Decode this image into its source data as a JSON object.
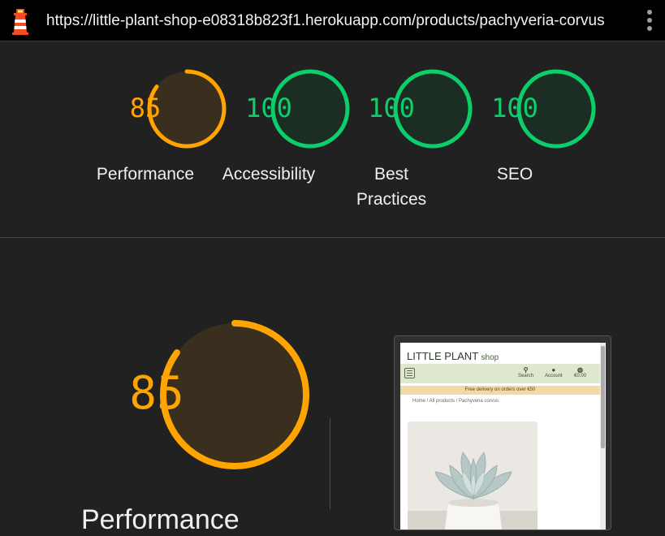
{
  "browser": {
    "url": "https://little-plant-shop-e08318b823f1.herokuapp.com/products/pachyveria-corvus",
    "logo_icon": "lighthouse-icon",
    "menu_icon": "kebab-menu-icon"
  },
  "colors": {
    "average": "#ffa400",
    "pass": "#0cce6b",
    "average_fill": "#3a2e1e",
    "pass_fill": "#1c2e24"
  },
  "scores": [
    {
      "value": 85,
      "label_line1": "Performance",
      "label_line2": "",
      "status": "average"
    },
    {
      "value": 100,
      "label_line1": "Accessibility",
      "label_line2": "",
      "status": "pass"
    },
    {
      "value": 100,
      "label_line1": "Best",
      "label_line2": "Practices",
      "status": "pass"
    },
    {
      "value": 100,
      "label_line1": "SEO",
      "label_line2": "",
      "status": "pass"
    }
  ],
  "detail": {
    "score": 85,
    "title": "Performance"
  },
  "thumbnail": {
    "brand": "LITTLE PLANT",
    "brand_suffix": "shop",
    "nav": {
      "search": "Search",
      "account": "Account",
      "cart": "€0.00"
    },
    "banner": "Free delivery on orders over €50",
    "breadcrumb": "Home / All products / Pachyveria corvus"
  }
}
